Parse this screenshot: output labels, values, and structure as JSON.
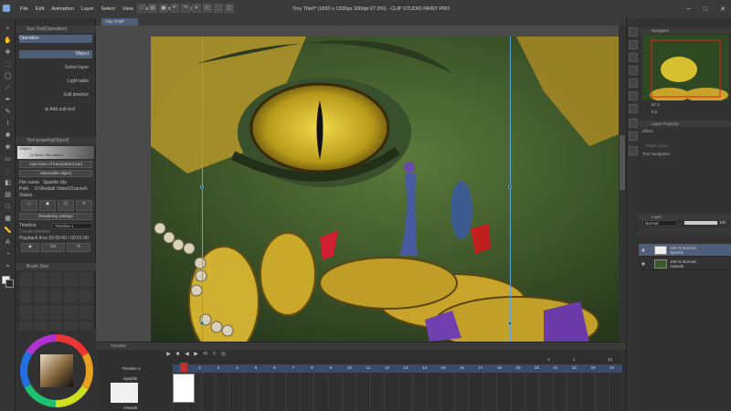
{
  "menu": [
    "File",
    "Edit",
    "Animation",
    "Layer",
    "Select",
    "View",
    "Filter",
    "Window",
    "Help"
  ],
  "title": "Tiny Thief* (1650 x 1200px 300dpi 67.3%)  - CLIP STUDIO PAINT PRO",
  "doc_tab": "Tiny Thief*",
  "sub_tool": {
    "header": "Sub Tool[Operation]",
    "operation": "Operation",
    "items": [
      "Object",
      "Select layer",
      "Light table",
      "Edit timeline"
    ],
    "add": "Add sub tool"
  },
  "tool_property": {
    "header": "Tool property[Object]",
    "object_label": "Object",
    "object_value": "(1 items / file object)",
    "transparent_label": "Operation of transparent part",
    "selectable": "Selectable object",
    "file_name_label": "File name",
    "file_name": "Sparkle.clip",
    "path_label": "Path",
    "path": "D:\\Redtail Video\\Channel\\",
    "status_label": "Status",
    "rendering": "Rendering settings",
    "timeline_label": "Timeline",
    "timeline_value": "Timeline 1",
    "create_timeline": "Create timeline",
    "playback": "Playback time 00:00:00 / 00:01:00",
    "speed": "1/4"
  },
  "brush_size": "Brush Size",
  "navigator": {
    "header": "Navigator",
    "zoom": "67.3",
    "rotate": "0.0"
  },
  "layer_property": {
    "header": "Layer Property",
    "effect": "Effect",
    "paper_color": "Paper Color",
    "tool_navigation": "Tool navigation"
  },
  "layer_panel": {
    "header": "Layer",
    "blend": "Normal",
    "opacity": "100",
    "layers": [
      {
        "l1": "100 % Normal",
        "l2": "Sparkle"
      },
      {
        "l1": "100 % Normal",
        "l2": "Artwork"
      }
    ]
  },
  "timeline": {
    "header": "Timeline",
    "name": "Timeline 1",
    "marks": [
      "1",
      "2",
      "3",
      "4",
      "5",
      "6",
      "7",
      "8",
      "9",
      "10",
      "11",
      "12",
      "13",
      "14",
      "15",
      "16",
      "17",
      "18",
      "19",
      "20",
      "21",
      "22",
      "23",
      "24"
    ],
    "top_marks": [
      "1",
      "13",
      "24"
    ],
    "rows": [
      "Sparkle",
      "Artwork"
    ],
    "counter_a": "1",
    "counter_b": "1",
    "counter_c": "24"
  },
  "colors": {
    "accent": "#4f5f78",
    "guide": "#5da4d8",
    "ruler": "#3a4a6a"
  }
}
